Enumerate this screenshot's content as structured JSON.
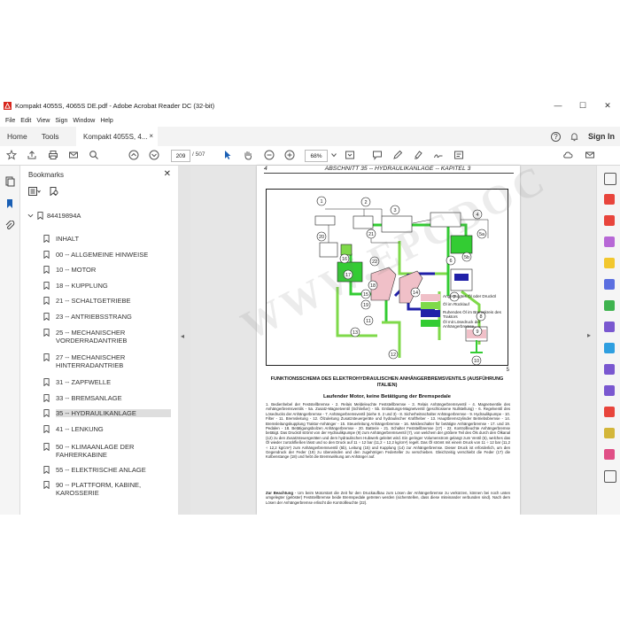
{
  "window": {
    "title": "Kompakt 4055S, 4065S DE.pdf - Adobe Acrobat Reader DC (32-bit)",
    "min": "—",
    "max": "☐",
    "close": "✕"
  },
  "menu": [
    "File",
    "Edit",
    "View",
    "Sign",
    "Window",
    "Help"
  ],
  "tabs": {
    "home": "Home",
    "tools": "Tools",
    "document": "Kompakt 4055S, 4...",
    "close": "×",
    "help": "?",
    "bell": "🔔",
    "signin": "Sign In"
  },
  "toolbar": {
    "page_current": "209",
    "page_total": "/ 507",
    "zoom": "68%"
  },
  "bookmarks": {
    "header": "Bookmarks",
    "close": "✕",
    "root": "84419894A",
    "items": [
      {
        "label": "INHALT"
      },
      {
        "label": "00 -- ALLGEMEINE HINWEISE"
      },
      {
        "label": "10 -- MOTOR"
      },
      {
        "label": "18 -- KUPPLUNG"
      },
      {
        "label": "21 -- SCHALTGETRIEBE"
      },
      {
        "label": "23 -- ANTRIEBSSTRANG"
      },
      {
        "label": "25 -- MECHANISCHER VORDERRADANTRIEB"
      },
      {
        "label": "27 -- MECHANISCHER HINTERRADANTRIEB"
      },
      {
        "label": "31 -- ZAPFWELLE"
      },
      {
        "label": "33 -- BREMSANLAGE"
      },
      {
        "label": "35 -- HYDRAULIKANLAGE"
      },
      {
        "label": "41 -- LENKUNG"
      },
      {
        "label": "50 -- KLIMAANLAGE DER FAHRERKABINE"
      },
      {
        "label": "55 -- ELEKTRISCHE ANLAGE"
      },
      {
        "label": "90 -- PLATTFORM, KABINE, KAROSSERIE"
      }
    ]
  },
  "page": {
    "number": "4",
    "header": "ABSCHNITT 35 -- HYDRAULIKANLAGE -- KAPITEL 3",
    "figure_number": "5",
    "legend": [
      {
        "label": "Angesaugtes Öl oder Drucköl",
        "color": "#f0c0c8"
      },
      {
        "label": "Öl im Rücklauf",
        "color": "#7fd94a"
      },
      {
        "label": "Ruhendes Öl im Bremskreis des Traktors",
        "color": "#2020a8"
      },
      {
        "label": "Öl mit Lösedruck der Anhängerbremse",
        "color": "#33cc33"
      }
    ],
    "caption": "FUNKTIONSSCHEMA DES ELEKTROHYDRAULISCHEN ANHÄNGERBREMSVENTILS (AUSFÜHRUNG ITALIEN)",
    "subtitle": "Laufender Motor, keine Betätigung der Bremspedale",
    "body": "1. Bedienhebel der Feststellbremse - 2. Relais Meldeleuchte Feststellbremse - 3. Relais Anhängerbremsventil - 4. Magnetventile des Anhängerbremsventils - 5a. Zusatz-Magnetventil (Schließer) - 5b. Entlastungs-Magnetventil (geschlossene Nullstellung) - 6. Regelventil des Lösedrucks der Anhängerbremse - 7. Anhängerbremsventil (siehe S. 2 und 3) - 8. Sicherheitsschalter Anhängerbremse - 9. Hydraulikpumpe - 10. Filter - 11. Bremsleitung - 12. Ölzuleitung Zusatzsteuergeräte und hydraulischer Kraftheber - 13. Hauptbremszylinder Betriebsbremse - 14. Bremsleitungskupplung Traktor-Anhänger - 15. Steuerleitung Anhängerbremse - 16. Meldeschalter für betätigte Anhängerbremse - 17. und 19. Pedalen - 18. Betätigungsbolzen Anhängerbremse - 20. Batterie - 21. Schalter Feststellbremse (17) - 22. Kontrollleuchte Anhängerbremse betätigt. Das Drucköl strömt von der Hydraulikpumpe (9) zum Anhängerbremsventil (7), von welchem der größere Teil des Öls durch den Ölkanal (12) zu den Zusatzsteuergeräten und dem hydraulischen Hubwerk geleitet wird. Ein geringer Volumenstrom gelangt zum Ventil (6), welches das Öl wieder zurückfließen lässt und so den Druck auf 11 ÷ 12 bar (11,2 ÷ 12,2 kg/cm²) regelt. Das Öl strömt mit einem Druck von 11 ÷ 12 bar (11,2 ÷ 12,2 kg/cm²) zum Anhängerbremsventil (5b), Leitung (15) und Kupplung (14) zur Anhängerbremse. Dieser Druck ist erforderlich, um den Gegendruck der Feder (19) zu überwinden und den zugehörigen Federteller zu verschieben. Gleichzeitig verschiebt die Feder (17) die Kolbenstange (18) und hebt die Bremswirkung am Anhänger auf.",
    "body2_title": "Zur Beachtung",
    "body2": " - Um beim Motorstart die Zeit für den Druckaufbau zum Lösen der Anhängerbremse zu verkürzen, können bei noch unten umgelegter (gelöster) Feststellbremse beide Bremspedale getreten werden (sicherstellen, dass diese miteinander verbunden sind). Nach dem Lösen der Anhängerbremse erlischt die Kontrollleuchte (22)."
  },
  "figure_callouts": [
    "1",
    "2",
    "3",
    "4",
    "5a",
    "5b",
    "6",
    "7",
    "8",
    "9",
    "10",
    "11",
    "12",
    "13",
    "14",
    "15",
    "16",
    "17",
    "18",
    "19",
    "20",
    "21",
    "22"
  ],
  "watermark": "WWW.EPCDOC"
}
